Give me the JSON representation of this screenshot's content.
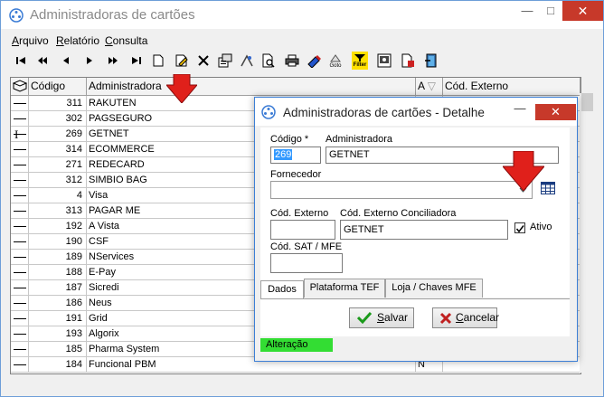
{
  "window": {
    "title": "Administradoras de cartões"
  },
  "menu": [
    {
      "label": "Arquivo",
      "u": "A",
      "rest": "rquivo"
    },
    {
      "label": "Relatório",
      "u": "R",
      "rest": "elatório"
    },
    {
      "label": "Consulta",
      "u": "C",
      "rest": "onsulta"
    }
  ],
  "toolbar": {
    "icons": [
      "first-icon",
      "prev-page-icon",
      "prev-icon",
      "next-icon",
      "next-page-icon",
      "last-icon",
      "new-icon",
      "edit-icon",
      "delete-icon",
      "properties-icon",
      "find-icon",
      "find-doc-icon",
      "print-icon",
      "lookup-icon",
      "goto-icon",
      "filter-icon",
      "grid-config-icon",
      "export-icon",
      "exit-icon"
    ],
    "goto_label": "Goto",
    "filter_label": "Filter"
  },
  "grid": {
    "columns": {
      "codigo": "Código",
      "administradora": "Administradora",
      "ativo": "A",
      "externo": "Cód. Externo"
    },
    "rows": [
      {
        "codigo": "311",
        "nome": "RAKUTEN",
        "ativo": ""
      },
      {
        "codigo": "302",
        "nome": "PAGSEGURO",
        "ativo": ""
      },
      {
        "codigo": "269",
        "nome": "GETNET",
        "ativo": ""
      },
      {
        "codigo": "314",
        "nome": "ECOMMERCE",
        "ativo": ""
      },
      {
        "codigo": "271",
        "nome": "REDECARD",
        "ativo": ""
      },
      {
        "codigo": "312",
        "nome": "SIMBIO BAG",
        "ativo": ""
      },
      {
        "codigo": "4",
        "nome": "Visa",
        "ativo": ""
      },
      {
        "codigo": "313",
        "nome": "PAGAR ME",
        "ativo": ""
      },
      {
        "codigo": "192",
        "nome": "A Vista",
        "ativo": ""
      },
      {
        "codigo": "190",
        "nome": "CSF",
        "ativo": ""
      },
      {
        "codigo": "189",
        "nome": "NServices",
        "ativo": ""
      },
      {
        "codigo": "188",
        "nome": "E-Pay",
        "ativo": ""
      },
      {
        "codigo": "187",
        "nome": "Sicredi",
        "ativo": ""
      },
      {
        "codigo": "186",
        "nome": "Neus",
        "ativo": ""
      },
      {
        "codigo": "191",
        "nome": "Grid",
        "ativo": ""
      },
      {
        "codigo": "193",
        "nome": "Algorix",
        "ativo": ""
      },
      {
        "codigo": "185",
        "nome": "Pharma System",
        "ativo": ""
      },
      {
        "codigo": "184",
        "nome": "Funcional PBM",
        "ativo": "N"
      }
    ]
  },
  "dialog": {
    "title": "Administradoras de cartões - Detalhe",
    "codigo_label": "Código *",
    "codigo_value": "269",
    "admin_label": "Administradora",
    "admin_value": "GETNET",
    "fornecedor_label": "Fornecedor",
    "fornecedor_value": "",
    "cod_externo_label": "Cód. Externo",
    "cod_externo_value": "",
    "conciliadora_label": "Cód. Externo Conciliadora",
    "conciliadora_value": "GETNET",
    "ativo_label": "Ativo",
    "ativo_checked": true,
    "sat_label": "Cód. SAT / MFE",
    "sat_value": "",
    "tabs": [
      "Dados",
      "Plataforma TEF",
      "Loja / Chaves MFE"
    ],
    "save_u": "S",
    "save_rest": "alvar",
    "cancel_u": "C",
    "cancel_rest": "ancelar",
    "status": "Alteração"
  },
  "colors": {
    "accent": "#3c7fd6",
    "close": "#c7392a",
    "status": "#33dd33",
    "arrow": "#e0201b"
  }
}
